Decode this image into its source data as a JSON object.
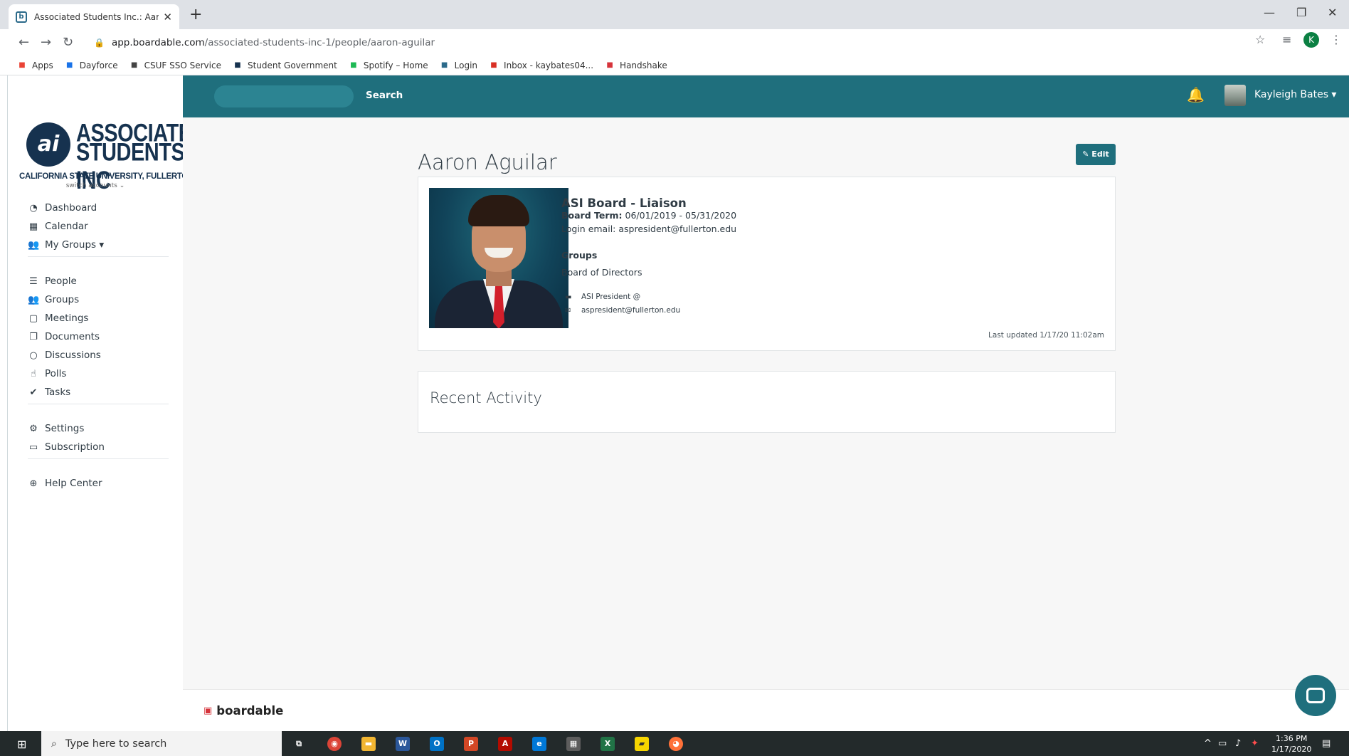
{
  "browser": {
    "tab_title": "Associated Students Inc.: Aaron A",
    "url_host": "app.boardable.com",
    "url_path": "/associated-students-inc-1/people/aaron-aguilar",
    "profile_initial": "K",
    "bookmarks": [
      {
        "label": "Apps",
        "icon": "apps-grid-icon",
        "color": "#ea4335"
      },
      {
        "label": "Dayforce",
        "icon": "dayforce-icon",
        "color": "#1a73e8"
      },
      {
        "label": "CSUF SSO Service",
        "icon": "building-icon",
        "color": "#444"
      },
      {
        "label": "Student Government",
        "icon": "asi-icon",
        "color": "#16324f"
      },
      {
        "label": "Spotify – Home",
        "icon": "spotify-icon",
        "color": "#1db954"
      },
      {
        "label": "Login",
        "icon": "boardable-icon",
        "color": "#2b6a8a"
      },
      {
        "label": "Inbox - kaybates04...",
        "icon": "gmail-icon",
        "color": "#d93025"
      },
      {
        "label": "Handshake",
        "icon": "handshake-icon",
        "color": "#d6343b"
      }
    ]
  },
  "sidebar": {
    "logo_line1": "ASSOCIATED",
    "logo_line2": "STUDENTS INC",
    "logo_line3": "CALIFORNIA STATE UNIVERSITY, FULLERTON™",
    "switch_accounts": "switch accounts ⌄",
    "nav_primary": [
      {
        "label": "Dashboard",
        "icon": "dashboard-icon",
        "glyph": "◔"
      },
      {
        "label": "Calendar",
        "icon": "calendar-icon",
        "glyph": "▦"
      },
      {
        "label": "My Groups ▾",
        "icon": "users-icon",
        "glyph": "👥"
      }
    ],
    "nav_secondary": [
      {
        "label": "People",
        "icon": "list-icon",
        "glyph": "☰"
      },
      {
        "label": "Groups",
        "icon": "users-icon",
        "glyph": "👥"
      },
      {
        "label": "Meetings",
        "icon": "calendar-icon",
        "glyph": "▢"
      },
      {
        "label": "Documents",
        "icon": "documents-icon",
        "glyph": "❐"
      },
      {
        "label": "Discussions",
        "icon": "comment-icon",
        "glyph": "○"
      },
      {
        "label": "Polls",
        "icon": "hand-icon",
        "glyph": "☝"
      },
      {
        "label": "Tasks",
        "icon": "check-icon",
        "glyph": "✔"
      }
    ],
    "nav_tertiary": [
      {
        "label": "Settings",
        "icon": "gears-icon",
        "glyph": "⚙"
      },
      {
        "label": "Subscription",
        "icon": "credit-card-icon",
        "glyph": "▭"
      }
    ],
    "nav_help": [
      {
        "label": "Help Center",
        "icon": "life-ring-icon",
        "glyph": "⊕"
      }
    ]
  },
  "topnav": {
    "search_label": "Search",
    "user_name": "Kayleigh Bates ▾"
  },
  "profile": {
    "name": "Aaron Aguilar",
    "edit_label": "✎ Edit",
    "role": "ASI Board - Liaison",
    "board_term_label": "Board Term:",
    "board_term_value": "06/01/2019 - 05/31/2020",
    "login_email_label": "Login email:",
    "login_email_value": "aspresident@fullerton.edu",
    "groups_heading": "Groups",
    "groups": [
      "Board of Directors"
    ],
    "contact_title": "ASI President @",
    "contact_email": "aspresident@fullerton.edu",
    "last_updated": "Last updated 1/17/20 11:02am"
  },
  "activity": {
    "title": "Recent Activity"
  },
  "footer": {
    "brand": "boardable"
  },
  "taskbar": {
    "search_placeholder": "Type here to search",
    "time": "1:36 PM",
    "date": "1/17/2020"
  }
}
